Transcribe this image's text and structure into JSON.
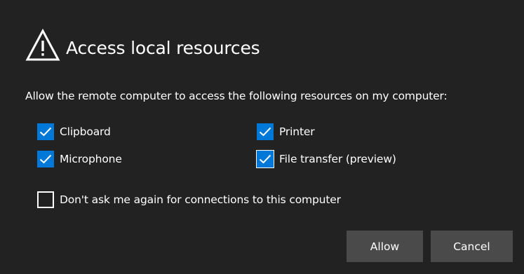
{
  "dialog": {
    "title": "Access local resources",
    "prompt": "Allow the remote computer to access the following resources on my computer:",
    "resources": [
      {
        "label": "Clipboard",
        "checked": true
      },
      {
        "label": "Printer",
        "checked": true
      },
      {
        "label": "Microphone",
        "checked": true
      },
      {
        "label": "File transfer (preview)",
        "checked": true
      }
    ],
    "dont_ask": {
      "label": "Don't ask me again for connections to this computer",
      "checked": false
    },
    "allow_label": "Allow",
    "cancel_label": "Cancel"
  },
  "colors": {
    "background": "#222222",
    "checkbox_accent": "#0078d7",
    "button": "#4a4a4a",
    "text": "#ffffff"
  },
  "icons": {
    "title_icon": "warning-icon",
    "check_glyph": "checkmark-icon"
  }
}
